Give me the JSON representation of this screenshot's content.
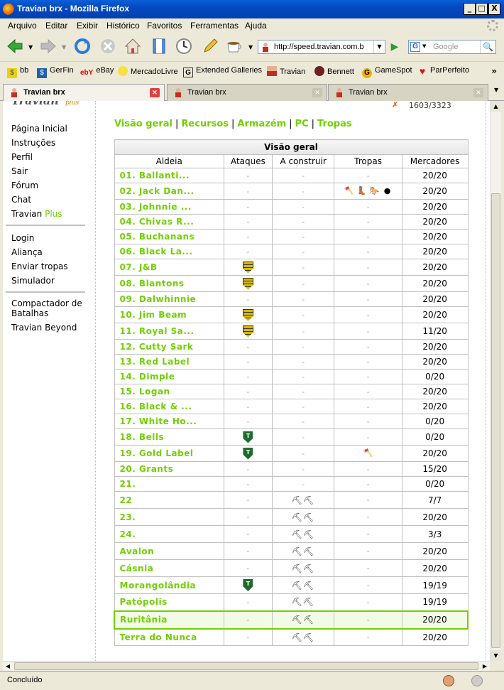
{
  "window": {
    "title": "Travian brx - Mozilla Firefox",
    "min": "_",
    "max": "□",
    "close": "X"
  },
  "menu": [
    "Arquivo",
    "Editar",
    "Exibir",
    "Histórico",
    "Favoritos",
    "Ferramentas",
    "Ajuda"
  ],
  "address": {
    "url": "http://speed.travian.com.b"
  },
  "search": {
    "placeholder": "Google",
    "engine": "G"
  },
  "bookmarks": [
    "bb",
    "GerFin",
    "eBay",
    "MercadoLivre",
    "Extended Galleries",
    "Travian",
    "Bennett",
    "GameSpot",
    "ParPerfeito"
  ],
  "bookmarks_overflow": "»",
  "tabs": [
    "Travian brx",
    "Travian brx",
    "Travian brx"
  ],
  "status": "Concluído",
  "page": {
    "logo": "Travian",
    "logo_plus": "plus",
    "resources_top": "1603/3323",
    "sidebar_group1": [
      "Página Inicial",
      "Instruções",
      "Perfil",
      "Sair",
      "Fórum",
      "Chat"
    ],
    "travian_label": "Travian",
    "plus_label": "Plus",
    "sidebar_group2": [
      "Login",
      "Aliança",
      "Enviar tropas",
      "Simulador"
    ],
    "sidebar_group3": [
      "Compactador de Batalhas",
      "Travian Beyond"
    ],
    "subnav": [
      "Visão geral",
      "Recursos",
      "Armazém",
      "PC",
      "Tropas"
    ],
    "subnav_sep": "|",
    "table": {
      "caption": "Visão geral",
      "headers": [
        "Aldeia",
        "Ataques",
        "A construir",
        "Tropas",
        "Mercadores"
      ],
      "rows": [
        {
          "name": "01. Ballanti...",
          "attack": "-",
          "build": "-",
          "troops": "-",
          "merc": "20/20"
        },
        {
          "name": "02. Jack Dan...",
          "attack": "-",
          "build": "-",
          "troops": "icons",
          "merc": "20/20"
        },
        {
          "name": "03. Johnnie ...",
          "attack": "-",
          "build": "-",
          "troops": "-",
          "merc": "20/20"
        },
        {
          "name": "04. Chivas R...",
          "attack": "-",
          "build": "-",
          "troops": "-",
          "merc": "20/20"
        },
        {
          "name": "05. Buchanans",
          "attack": "-",
          "build": "-",
          "troops": "-",
          "merc": "20/20"
        },
        {
          "name": "06. Black La...",
          "attack": "-",
          "build": "-",
          "troops": "-",
          "merc": "20/20"
        },
        {
          "name": "07. J&B",
          "attack": "yellow",
          "build": "-",
          "troops": "-",
          "merc": "20/20"
        },
        {
          "name": "08. Blantons",
          "attack": "yellow",
          "build": "-",
          "troops": "-",
          "merc": "20/20"
        },
        {
          "name": "09. Dalwhinnie",
          "attack": "-",
          "build": "-",
          "troops": "-",
          "merc": "20/20"
        },
        {
          "name": "10. Jim Beam",
          "attack": "yellow",
          "build": "-",
          "troops": "-",
          "merc": "20/20"
        },
        {
          "name": "11. Royal Sa...",
          "attack": "yellow",
          "build": "-",
          "troops": "-",
          "merc": "11/20"
        },
        {
          "name": "12. Cutty Sark",
          "attack": "-",
          "build": "-",
          "troops": "-",
          "merc": "20/20"
        },
        {
          "name": "13. Red Label",
          "attack": "-",
          "build": "-",
          "troops": "-",
          "merc": "20/20"
        },
        {
          "name": "14. Dimple",
          "attack": "-",
          "build": "-",
          "troops": "-",
          "merc": "0/20"
        },
        {
          "name": "15. Logan",
          "attack": "-",
          "build": "-",
          "troops": "-",
          "merc": "20/20"
        },
        {
          "name": "16. Black & ...",
          "attack": "-",
          "build": "-",
          "troops": "-",
          "merc": "20/20"
        },
        {
          "name": "17. White Ho...",
          "attack": "-",
          "build": "-",
          "troops": "-",
          "merc": "0/20"
        },
        {
          "name": "18. Bells",
          "attack": "green",
          "build": "-",
          "troops": "-",
          "merc": "0/20"
        },
        {
          "name": "19. Gold Label",
          "attack": "green",
          "build": "-",
          "troops": "axe",
          "merc": "20/20"
        },
        {
          "name": "20. Grants",
          "attack": "-",
          "build": "-",
          "troops": "-",
          "merc": "15/20"
        },
        {
          "name": "21.",
          "attack": "-",
          "build": "-",
          "troops": "-",
          "merc": "0/20"
        },
        {
          "name": "22",
          "attack": "-",
          "build": "tools",
          "troops": "-",
          "merc": "7/7"
        },
        {
          "name": "23.",
          "attack": "-",
          "build": "tools",
          "troops": "-",
          "merc": "20/20"
        },
        {
          "name": "24.",
          "attack": "-",
          "build": "tools",
          "troops": "-",
          "merc": "3/3"
        },
        {
          "name": "Avalon",
          "attack": "-",
          "build": "tools",
          "troops": "-",
          "merc": "20/20"
        },
        {
          "name": "Cásnia",
          "attack": "-",
          "build": "tools",
          "troops": "-",
          "merc": "20/20"
        },
        {
          "name": "Morangolândia",
          "attack": "green",
          "build": "tools",
          "troops": "-",
          "merc": "19/19"
        },
        {
          "name": "Patópolis",
          "attack": "-",
          "build": "tools",
          "troops": "-",
          "merc": "19/19"
        },
        {
          "name": "Ruritânia",
          "attack": "-",
          "build": "tools",
          "troops": "-",
          "merc": "20/20",
          "highlight": true
        },
        {
          "name": "Terra do Nunca",
          "attack": "-",
          "build": "tools",
          "troops": "-",
          "merc": "20/20"
        }
      ]
    }
  },
  "colors": {
    "accent": "#71d000",
    "title_bar": "#0449c2"
  },
  "icons": {
    "build": "construction-tools-icon",
    "attack_yellow": "incoming-attack-shield-icon",
    "attack_green": "own-attack-shield-icon"
  }
}
